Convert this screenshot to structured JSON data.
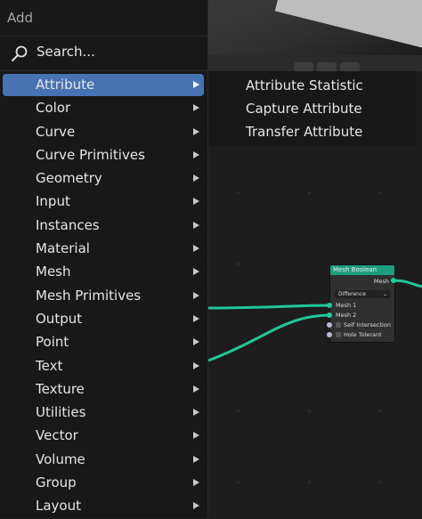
{
  "menu": {
    "title": "Add",
    "search_label": "Search...",
    "items": [
      {
        "label": "Attribute",
        "active": true
      },
      {
        "label": "Color"
      },
      {
        "label": "Curve"
      },
      {
        "label": "Curve Primitives"
      },
      {
        "label": "Geometry"
      },
      {
        "label": "Input"
      },
      {
        "label": "Instances"
      },
      {
        "label": "Material"
      },
      {
        "label": "Mesh"
      },
      {
        "label": "Mesh Primitives"
      },
      {
        "label": "Output"
      },
      {
        "label": "Point"
      },
      {
        "label": "Text"
      },
      {
        "label": "Texture"
      },
      {
        "label": "Utilities"
      },
      {
        "label": "Vector"
      },
      {
        "label": "Volume"
      },
      {
        "label": "Group"
      },
      {
        "label": "Layout"
      }
    ]
  },
  "submenu": {
    "items": [
      {
        "label": "Attribute Statistic"
      },
      {
        "label": "Capture Attribute"
      },
      {
        "label": "Transfer Attribute"
      }
    ]
  },
  "node": {
    "title": "Mesh Boolean",
    "output_label": "Mesh",
    "operation": "Difference",
    "input_mesh1": "Mesh 1",
    "input_mesh2": "Mesh 2",
    "option_self_intersection": "Self Intersection",
    "option_hole_tolerant": "Hole Tolerant"
  },
  "colors": {
    "highlight": "#4772b3",
    "node_header": "#1d9e7e",
    "link": "#1fc89a"
  }
}
